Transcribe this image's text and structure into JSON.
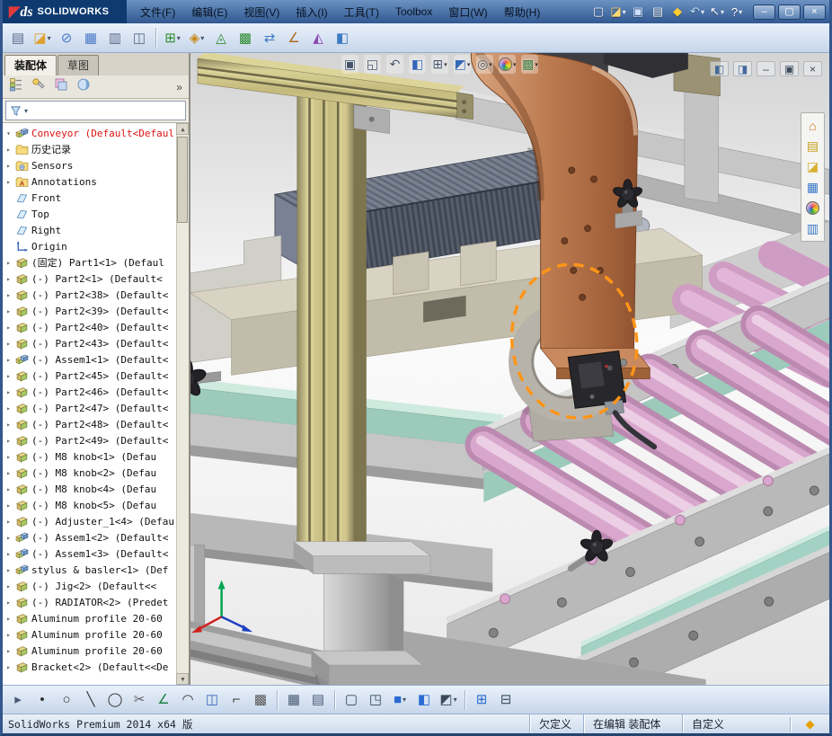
{
  "colors": {
    "titlebar-top": "#6b92c2",
    "titlebar-bottom": "#315891",
    "logo-bg": "#0e3a70",
    "toolbar-top": "#eaf1fb",
    "toolbar-bottom": "#c6d6ea",
    "panel-bg": "#efede6",
    "tree-bg": "#ffffff",
    "statusbar-bg": "#cfdcec",
    "copper": "#bd7c52",
    "olive": "#c4ba7c",
    "pink": "#d9a6cd",
    "teal": "#a3d2c4",
    "radiator": "#5b6270",
    "highlight": "#ff9518",
    "root-alert": "#dd1111"
  },
  "titlebar": {
    "logo_ds": "ds",
    "logo_text": "SOLIDWORKS",
    "menus": [
      {
        "name": "menu-file",
        "label": "文件(F)"
      },
      {
        "name": "menu-edit",
        "label": "编辑(E)"
      },
      {
        "name": "menu-view",
        "label": "视图(V)"
      },
      {
        "name": "menu-insert",
        "label": "插入(I)"
      },
      {
        "name": "menu-tools",
        "label": "工具(T)"
      },
      {
        "name": "menu-toolbox",
        "label": "Toolbox"
      },
      {
        "name": "menu-window",
        "label": "窗口(W)"
      },
      {
        "name": "menu-help",
        "label": "帮助(H)"
      }
    ],
    "quick_icons": [
      {
        "name": "new-document",
        "glyph": "▢",
        "fg": "#f2f6ff"
      },
      {
        "name": "open-document",
        "glyph": "◪",
        "fg": "#ffd870",
        "caret": "▾"
      },
      {
        "name": "save",
        "glyph": "▣",
        "fg": "#cfe0ff"
      },
      {
        "name": "print",
        "glyph": "▤",
        "fg": "#e8eef8"
      },
      {
        "name": "error-report",
        "glyph": "◆",
        "fg": "#ffcc33"
      },
      {
        "name": "undo",
        "glyph": "↶",
        "fg": "#bfe0ff",
        "caret": "▾"
      },
      {
        "name": "select",
        "glyph": "↖",
        "fg": "#ffffff",
        "caret": "▾"
      },
      {
        "name": "help",
        "glyph": "?",
        "fg": "#ffffff",
        "caret": "▾"
      }
    ],
    "window_buttons": [
      {
        "name": "minimize-window",
        "glyph": "–"
      },
      {
        "name": "maximize-window",
        "glyph": "▢"
      },
      {
        "name": "close-window",
        "glyph": "×"
      }
    ]
  },
  "toolbar": {
    "items": [
      {
        "name": "paste",
        "glyph": "▤",
        "fg": "#5a6a8a"
      },
      {
        "name": "open-document",
        "glyph": "◪",
        "fg": "#e0a030",
        "caret": "▾"
      },
      {
        "name": "mate",
        "glyph": "⊘",
        "fg": "#4a78c8"
      },
      {
        "name": "linear-component-pattern",
        "glyph": "▦",
        "fg": "#4a78c8"
      },
      {
        "name": "print",
        "glyph": "▥",
        "fg": "#5a6a8a"
      },
      {
        "name": "print-preview",
        "glyph": "◫",
        "fg": "#5a6a8a"
      },
      {
        "sep": true
      },
      {
        "name": "insert-component",
        "glyph": "⊞",
        "fg": "#2e8b2e",
        "caret": "▾"
      },
      {
        "name": "smart-fasteners",
        "glyph": "◈",
        "fg": "#c8881a",
        "caret": "▾"
      },
      {
        "name": "exploded-view",
        "glyph": "◬",
        "fg": "#2e8b2e"
      },
      {
        "name": "assembly-features",
        "glyph": "▩",
        "fg": "#2e8b2e"
      },
      {
        "name": "move-component",
        "glyph": "⇄",
        "fg": "#3a7ac0"
      },
      {
        "name": "measure",
        "glyph": "∠",
        "fg": "#b06a20"
      },
      {
        "name": "interference-detection",
        "glyph": "◭",
        "fg": "#8a4ab0"
      },
      {
        "name": "section-properties",
        "glyph": "◧",
        "fg": "#3a7ac0"
      }
    ]
  },
  "panel": {
    "tabs": [
      {
        "name": "tab-assembly",
        "label": "装配体",
        "active": true
      },
      {
        "name": "tab-sketch",
        "label": "草图",
        "active": false
      }
    ],
    "manager_tabs": [
      {
        "name": "featuremanager-design-tree",
        "icon": "fm-tree"
      },
      {
        "name": "propertymanager",
        "icon": "fm-property"
      },
      {
        "name": "configurationmanager",
        "icon": "fm-config"
      },
      {
        "name": "displaymanager",
        "icon": "fm-display"
      }
    ],
    "overflow": "»",
    "filter": {
      "caret": "▾"
    },
    "scrollbar": {
      "up": "▲",
      "down": "▼"
    },
    "tree": [
      {
        "name": "tree-item-root",
        "icon": "assembly",
        "label": "Conveyor (Default<Defaul",
        "arrow": "▾",
        "color": "#dd1111"
      },
      {
        "name": "tree-item-history",
        "icon": "folder",
        "label": "历史记录",
        "arrow": "▸"
      },
      {
        "name": "tree-item-sensors",
        "icon": "folder-eye",
        "label": "Sensors",
        "arrow": "▸"
      },
      {
        "name": "tree-item-annotations",
        "icon": "folder-note",
        "label": "Annotations",
        "arrow": "▸"
      },
      {
        "name": "tree-item-front-plane",
        "icon": "plane",
        "label": "Front",
        "arrow": ""
      },
      {
        "name": "tree-item-top-plane",
        "icon": "plane",
        "label": "Top",
        "arrow": ""
      },
      {
        "name": "tree-item-right-plane",
        "icon": "plane",
        "label": "Right",
        "arrow": ""
      },
      {
        "name": "tree-item-origin",
        "icon": "origin",
        "label": "Origin",
        "arrow": ""
      },
      {
        "name": "tree-item-part1",
        "icon": "part",
        "label": "(固定) Part1<1> (Defaul",
        "arrow": "▸"
      },
      {
        "name": "tree-item-part2-1",
        "icon": "part",
        "label": "(-) Part2<1> (Default<",
        "arrow": "▸"
      },
      {
        "name": "tree-item-part2-38",
        "icon": "part",
        "label": "(-) Part2<38> (Default<",
        "arrow": "▸"
      },
      {
        "name": "tree-item-part2-39",
        "icon": "part",
        "label": "(-) Part2<39> (Default<",
        "arrow": "▸"
      },
      {
        "name": "tree-item-part2-40",
        "icon": "part",
        "label": "(-) Part2<40> (Default<",
        "arrow": "▸"
      },
      {
        "name": "tree-item-part2-43",
        "icon": "part",
        "label": "(-) Part2<43> (Default<",
        "arrow": "▸"
      },
      {
        "name": "tree-item-assem1-1",
        "icon": "assembly",
        "label": "(-) Assem1<1> (Default<",
        "arrow": "▸"
      },
      {
        "name": "tree-item-part2-45",
        "icon": "part",
        "label": "(-) Part2<45> (Default<",
        "arrow": "▸"
      },
      {
        "name": "tree-item-part2-46",
        "icon": "part",
        "label": "(-) Part2<46> (Default<",
        "arrow": "▸"
      },
      {
        "name": "tree-item-part2-47",
        "icon": "part",
        "label": "(-) Part2<47> (Default<",
        "arrow": "▸"
      },
      {
        "name": "tree-item-part2-48",
        "icon": "part",
        "label": "(-) Part2<48> (Default<",
        "arrow": "▸"
      },
      {
        "name": "tree-item-part2-49",
        "icon": "part",
        "label": "(-) Part2<49> (Default<",
        "arrow": "▸"
      },
      {
        "name": "tree-item-m8-knob-1",
        "icon": "part",
        "label": "(-) M8 knob<1> (Defau",
        "arrow": "▸"
      },
      {
        "name": "tree-item-m8-knob-2",
        "icon": "part",
        "label": "(-) M8 knob<2> (Defau",
        "arrow": "▸"
      },
      {
        "name": "tree-item-m8-knob-4",
        "icon": "part",
        "label": "(-) M8 knob<4> (Defau",
        "arrow": "▸"
      },
      {
        "name": "tree-item-m8-knob-5",
        "icon": "part",
        "label": "(-) M8 knob<5> (Defau",
        "arrow": "▸"
      },
      {
        "name": "tree-item-adjuster",
        "icon": "part",
        "label": "(-) Adjuster_1<4> (Defau",
        "arrow": "▸"
      },
      {
        "name": "tree-item-assem1-2",
        "icon": "assembly",
        "label": "(-) Assem1<2> (Default<",
        "arrow": "▸"
      },
      {
        "name": "tree-item-assem1-3",
        "icon": "assembly",
        "label": "(-) Assem1<3> (Default<",
        "arrow": "▸"
      },
      {
        "name": "tree-item-stylus-basler",
        "icon": "assembly",
        "label": "stylus & basler<1> (Def",
        "arrow": "▸"
      },
      {
        "name": "tree-item-jig",
        "icon": "part",
        "label": "(-) Jig<2> (Default<<",
        "arrow": "▸"
      },
      {
        "name": "tree-item-radiator",
        "icon": "part",
        "label": "(-) RADIATOR<2> (Predet",
        "arrow": "▸"
      },
      {
        "name": "tree-item-alu-profile-1",
        "icon": "part",
        "label": "Aluminum profile 20-60",
        "arrow": "▸"
      },
      {
        "name": "tree-item-alu-profile-2",
        "icon": "part",
        "label": "Aluminum profile 20-60",
        "arrow": "▸"
      },
      {
        "name": "tree-item-alu-profile-3",
        "icon": "part",
        "label": "Aluminum profile 20-60",
        "arrow": "▸"
      },
      {
        "name": "tree-item-bracket",
        "icon": "part",
        "label": "Bracket<2> (Default<<De",
        "arrow": "▸"
      }
    ]
  },
  "viewport": {
    "hud": [
      {
        "name": "zoom-fit",
        "glyph": "▣",
        "fg": "#44546a"
      },
      {
        "name": "zoom-area",
        "glyph": "◱",
        "fg": "#44546a"
      },
      {
        "name": "previous-view",
        "glyph": "↶",
        "fg": "#44546a"
      },
      {
        "name": "section-view",
        "glyph": "◧",
        "fg": "#3568b8"
      },
      {
        "name": "view-orientation",
        "glyph": "⊞",
        "fg": "#44546a",
        "caret": "▾"
      },
      {
        "name": "display-style",
        "glyph": "◩",
        "fg": "#3568b8",
        "caret": "▾"
      },
      {
        "name": "hide-show-items",
        "glyph": "◎",
        "fg": "#44546a",
        "caret": "▾"
      },
      {
        "name": "edit-appearance",
        "sphere": true,
        "caret": "▾"
      },
      {
        "name": "apply-scene",
        "glyph": "▩",
        "fg": "#3f7a3f",
        "caret": "▾"
      }
    ],
    "doc_buttons": [
      {
        "name": "pane-left",
        "glyph": "◧",
        "fg": "#44699c"
      },
      {
        "name": "pane-right",
        "glyph": "◨",
        "fg": "#44699c"
      },
      {
        "name": "minimize-document",
        "glyph": "–",
        "fg": "#3c4c5c"
      },
      {
        "name": "restore-document",
        "glyph": "▣",
        "fg": "#3c4c5c"
      },
      {
        "name": "close-document",
        "glyph": "×",
        "fg": "#3c4c5c"
      }
    ],
    "task_pane": [
      {
        "name": "solidworks-resources",
        "glyph": "⌂",
        "fg": "#d87018"
      },
      {
        "name": "design-library",
        "glyph": "▤",
        "fg": "#c8a018"
      },
      {
        "name": "file-explorer",
        "glyph": "◪",
        "fg": "#d8b030"
      },
      {
        "name": "view-palette",
        "glyph": "▦",
        "fg": "#3878c8"
      },
      {
        "name": "appearances",
        "sphere": true
      },
      {
        "name": "custom-properties",
        "glyph": "▥",
        "fg": "#3878c8"
      }
    ]
  },
  "bottom_toolbar": {
    "items": [
      {
        "name": "toolbar-expand",
        "glyph": "▸",
        "fg": "#4a5a74"
      },
      {
        "name": "sketch-point",
        "glyph": "•",
        "fg": "#303030"
      },
      {
        "name": "sketch-circle",
        "glyph": "○",
        "fg": "#303030"
      },
      {
        "name": "sketch-line",
        "glyph": "╲",
        "fg": "#303030"
      },
      {
        "name": "sketch-ellipse",
        "glyph": "◯",
        "fg": "#303030"
      },
      {
        "name": "sketch-trim",
        "glyph": "✂",
        "fg": "#606060"
      },
      {
        "name": "sketch-relation",
        "glyph": "∠",
        "fg": "#208040"
      },
      {
        "name": "sketch-arc",
        "glyph": "◠",
        "fg": "#303030"
      },
      {
        "name": "sketch-mirror",
        "glyph": "◫",
        "fg": "#3a6ac0"
      },
      {
        "name": "sketch-fillet",
        "glyph": "⌐",
        "fg": "#303030"
      },
      {
        "name": "sketch-pattern",
        "glyph": "▩",
        "fg": "#585858"
      },
      {
        "sep": true
      },
      {
        "name": "grid-settings",
        "glyph": "▦",
        "fg": "#4a5a74"
      },
      {
        "name": "plane-display",
        "glyph": "▤",
        "fg": "#4a5a74"
      },
      {
        "sep": true
      },
      {
        "name": "wireframe-mode",
        "glyph": "▢",
        "fg": "#3a4a5a"
      },
      {
        "name": "hidden-lines-mode",
        "glyph": "◳",
        "fg": "#3a4a5a"
      },
      {
        "name": "shaded-mode",
        "glyph": "■",
        "fg": "#2a6ad4",
        "caret": "▾"
      },
      {
        "name": "section-view",
        "glyph": "◧",
        "fg": "#2a6ad4"
      },
      {
        "name": "view-settings",
        "glyph": "◩",
        "fg": "#3a4a5a",
        "caret": "▾"
      },
      {
        "sep": true
      },
      {
        "name": "display-pane-table",
        "glyph": "⊞",
        "fg": "#2a6ad4"
      },
      {
        "name": "split-horizontal",
        "glyph": "⊟",
        "fg": "#3a4a5a"
      }
    ]
  },
  "statusbar": {
    "left": "SolidWorks Premium 2014 x64 版",
    "cells": [
      {
        "name": "status-constraint",
        "label": "欠定义"
      },
      {
        "name": "status-editing",
        "label": "在编辑 装配体"
      },
      {
        "name": "status-custom",
        "label": "自定义"
      }
    ],
    "quick_tips_glyph": "◆"
  }
}
